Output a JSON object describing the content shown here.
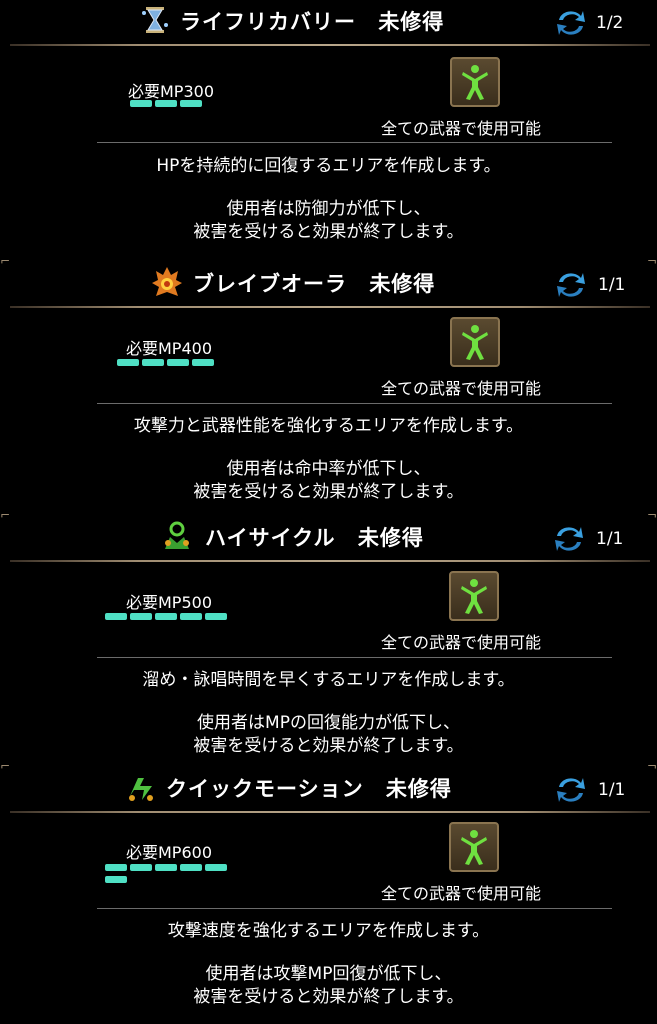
{
  "common": {
    "weapon_label": "全ての武器で使用可能",
    "status": "未修得"
  },
  "skills": [
    {
      "name": "ライフリカバリー",
      "status": "未修得",
      "page": "1/2",
      "mp": "必要MP300",
      "mp_bars": 3,
      "icon": "hourglass-icon",
      "desc1": "HPを持続的に回復するエリアを作成します。",
      "desc2": "使用者は防御力が低下し、",
      "desc3": "被害を受けると効果が終了します。"
    },
    {
      "name": "ブレイブオーラ",
      "status": "未修得",
      "page": "1/1",
      "mp": "必要MP400",
      "mp_bars": 4,
      "icon": "flame-aura-icon",
      "desc1": "攻撃力と武器性能を強化するエリアを作成します。",
      "desc2": "使用者は命中率が低下し、",
      "desc3": "被害を受けると効果が終了します。"
    },
    {
      "name": "ハイサイクル",
      "status": "未修得",
      "page": "1/1",
      "mp": "必要MP500",
      "mp_bars": 5,
      "icon": "green-cycle-icon",
      "desc1": "溜め・詠唱時間を早くするエリアを作成します。",
      "desc2": "使用者はMPの回復能力が低下し、",
      "desc3": "被害を受けると効果が終了します。"
    },
    {
      "name": "クイックモーション",
      "status": "未修得",
      "page": "1/1",
      "mp": "必要MP600",
      "mp_bars": 6,
      "icon": "green-speed-icon",
      "desc1": "攻撃速度を強化するエリアを作成します。",
      "desc2": "使用者は攻撃MP回復が低下し、",
      "desc3": "被害を受けると効果が終了します。"
    }
  ]
}
